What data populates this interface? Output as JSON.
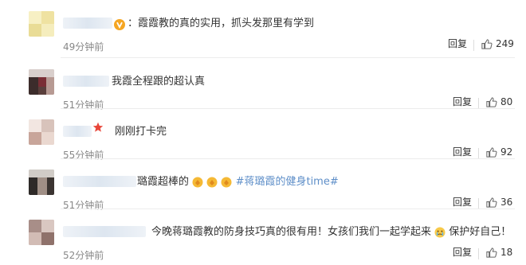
{
  "comments": [
    {
      "text": "霞霞教的真的实用，抓头发那里有学到",
      "time": "49分钟前",
      "reply_label": "回复",
      "likes": "249",
      "badge": "v-badge-icon"
    },
    {
      "text": "我霞全程跟的超认真",
      "time": "51分钟前",
      "reply_label": "回复",
      "likes": "80"
    },
    {
      "text": "刚刚打卡完",
      "time": "55分钟前",
      "reply_label": "回复",
      "likes": "92",
      "badge": "star-icon"
    },
    {
      "text_before": "璐霞超棒的",
      "emojis": [
        "clap-icon",
        "clap-icon",
        "clap-icon"
      ],
      "topic": "#蒋璐霞的健身time#",
      "time": "51分钟前",
      "reply_label": "回复",
      "likes": "36"
    },
    {
      "text_before": "今晚蒋璐霞教的防身技巧真的很有用！女孩们我们一起学起来",
      "emoji": "cry-icon",
      "text_after": "保护好自己！",
      "time": "52分钟前",
      "reply_label": "回复",
      "likes": "18"
    }
  ],
  "colors": {
    "text": "#333333",
    "muted": "#888888",
    "topic": "#5d8ec8",
    "badge_gold": "#f5a623",
    "star_red": "#e8463a"
  }
}
